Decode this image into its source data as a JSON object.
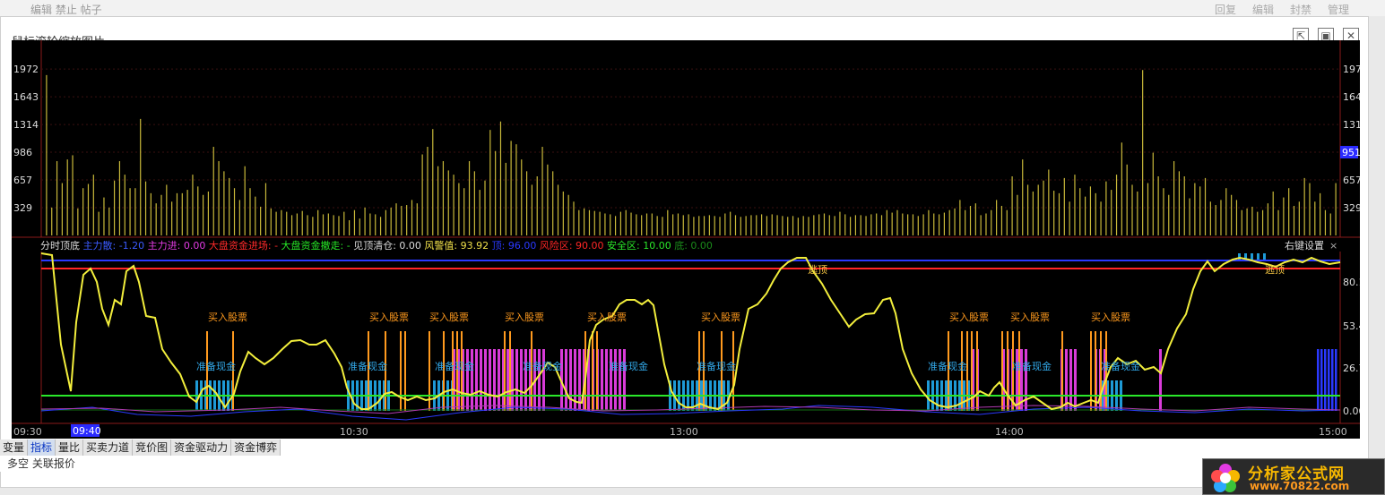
{
  "background": {
    "breadcrumb": "编辑 禁止 帖子",
    "actions": [
      "回复",
      "编辑",
      "封禁",
      "管理"
    ]
  },
  "dialog": {
    "title": "鼠标滚轮缩放图片",
    "buttons": {
      "open": "⇱",
      "restore": "▣",
      "close": "✕"
    }
  },
  "volume_panel": {
    "left_ticks": [
      "1972",
      "1643",
      "1314",
      "986",
      "657",
      "329"
    ],
    "right_ticks": [
      "197",
      "164",
      "131",
      "",
      "657",
      "329"
    ],
    "current_value_badge": "951",
    "bar_color": "#c9b93a"
  },
  "indicator_panel": {
    "legend": [
      {
        "text": "分时顶底",
        "color": "#dddddd"
      },
      {
        "text": "主力散: -1.20",
        "color": "#3b5bff"
      },
      {
        "text": "主力进: 0.00",
        "color": "#e23be2"
      },
      {
        "text": "大盘资金进场: -",
        "color": "#ff2a2a"
      },
      {
        "text": "大盘资金撤走: -",
        "color": "#26e626"
      },
      {
        "text": "见顶清仓: 0.00",
        "color": "#dddddd"
      },
      {
        "text": "风警值: 93.92",
        "color": "#f0e04a"
      },
      {
        "text": "顶: 96.00",
        "color": "#2a39ff"
      },
      {
        "text": "风险区: 90.00",
        "color": "#ff2626"
      },
      {
        "text": "安全区: 10.00",
        "color": "#2ae82a"
      },
      {
        "text": "底: 0.00",
        "color": "#1a8a1a"
      }
    ],
    "settings_label": "右键设置",
    "close_label": "×",
    "right_ticks": [
      "80.1",
      "53.4",
      "26.7",
      "0.00"
    ],
    "labels": {
      "buy": "买入股票",
      "prepare": "准备现金",
      "top": "逃顶"
    }
  },
  "time_axis": {
    "labels": [
      "09:30",
      "10:30",
      "13:00",
      "14:00",
      "15:00"
    ],
    "cursor_time": "09:40"
  },
  "bottom_tabs": [
    {
      "label": "变量",
      "active": false
    },
    {
      "label": "指标",
      "active": true
    },
    {
      "label": "量比",
      "active": false
    },
    {
      "label": "买卖力道",
      "active": false
    },
    {
      "label": "竞价图",
      "active": false
    },
    {
      "label": "资金驱动力",
      "active": false
    },
    {
      "label": "资金博弈",
      "active": false
    }
  ],
  "bottom_sub": "多空 关联报价",
  "watermark": {
    "title": "分析家公式网",
    "url": "www.70822.com"
  },
  "chart_data": {
    "type": "bar",
    "title": "",
    "ylim": [
      0,
      2100
    ],
    "values": [
      1900,
      330,
      880,
      620,
      900,
      950,
      320,
      560,
      610,
      720,
      280,
      450,
      330,
      650,
      880,
      720,
      560,
      560,
      1380,
      640,
      500,
      380,
      480,
      600,
      400,
      500,
      500,
      540,
      720,
      580,
      480,
      520,
      1050,
      880,
      760,
      680,
      560,
      420,
      820,
      560,
      460,
      340,
      620,
      320,
      280,
      300,
      280,
      240,
      260,
      290,
      240,
      220,
      300,
      250,
      260,
      240,
      230,
      280,
      180,
      300,
      200,
      330,
      260,
      250,
      220,
      300,
      330,
      380,
      350,
      360,
      420,
      380,
      960,
      1050,
      1260,
      820,
      880,
      770,
      720,
      620,
      560,
      880,
      760,
      540,
      650,
      1250,
      1000,
      1350,
      860,
      1120,
      1080,
      900,
      760,
      600,
      700,
      1050,
      840,
      760,
      600,
      520,
      480,
      400,
      300,
      320,
      300,
      290,
      280,
      260,
      250,
      230,
      280,
      300,
      270,
      250,
      240,
      260,
      260,
      230,
      220,
      300,
      250,
      260,
      240,
      250,
      220,
      230,
      230,
      240,
      230,
      220,
      260,
      280,
      240,
      220,
      230,
      240,
      240,
      250,
      230,
      250,
      240,
      230,
      220,
      230,
      210,
      230,
      220,
      240,
      250,
      260,
      240,
      230,
      280,
      250,
      220,
      240,
      240,
      230,
      250,
      260,
      240,
      300,
      270,
      300,
      260,
      250,
      250,
      230,
      250,
      300,
      260,
      250,
      270,
      300,
      320,
      420,
      300,
      350,
      380,
      240,
      260,
      300,
      420,
      350,
      300,
      700,
      480,
      900,
      600,
      520,
      600,
      650,
      780,
      530,
      500,
      680,
      400,
      720,
      560,
      460,
      580,
      500,
      400,
      640,
      540,
      720,
      1100,
      840,
      600,
      520,
      1960,
      620,
      980,
      700,
      560,
      480,
      880,
      760,
      700,
      440,
      620,
      580,
      680,
      400,
      360,
      420,
      560,
      480,
      420,
      300,
      320,
      340,
      280,
      300,
      380,
      520,
      300,
      450,
      560,
      350,
      400,
      680,
      620,
      400,
      500,
      300,
      260,
      620
    ]
  }
}
